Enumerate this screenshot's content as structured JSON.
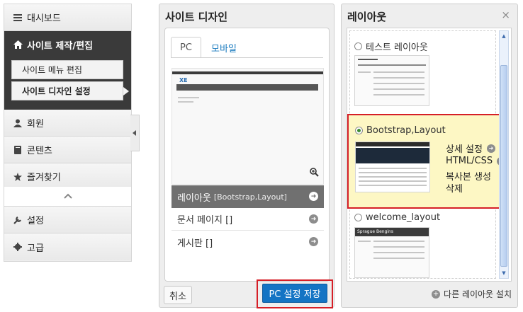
{
  "sidebar": {
    "dashboard": "대시보드",
    "site_menu": "사이트 제작/편집",
    "sub_menu_edit": "사이트 메뉴 편집",
    "sub_design": "사이트 디자인 설정",
    "members": "회원",
    "contents": "콘텐츠",
    "favorites": "즐겨찾기",
    "settings": "설정",
    "advanced": "고급"
  },
  "design_panel": {
    "title": "사이트 디자인",
    "tabs": [
      "PC",
      "모바일"
    ],
    "list": [
      {
        "label": "레이아웃",
        "sub": "[Bootstrap,Layout]"
      },
      {
        "label": "문서 페이지 []",
        "sub": ""
      },
      {
        "label": "게시판 []",
        "sub": ""
      }
    ],
    "cancel": "취소",
    "save": "PC 설정 저장",
    "preview_logo": "XE"
  },
  "layout_panel": {
    "title": "레이아웃",
    "close": "×",
    "options": [
      "테스트 레이아웃",
      "Bootstrap,Layout",
      "welcome_layout"
    ],
    "actions": [
      "상세 설정",
      "HTML/CSS",
      "복사본 생성",
      "삭제"
    ],
    "install": "다른 레이아웃 설치",
    "thumb_welcome_title": "Sprague Bengins"
  },
  "colors": {
    "accent_blue": "#1474c4",
    "highlight_red": "#d61f27",
    "selected_bg": "#fdf7c4",
    "sidebar_dark": "#3a3a3a"
  }
}
